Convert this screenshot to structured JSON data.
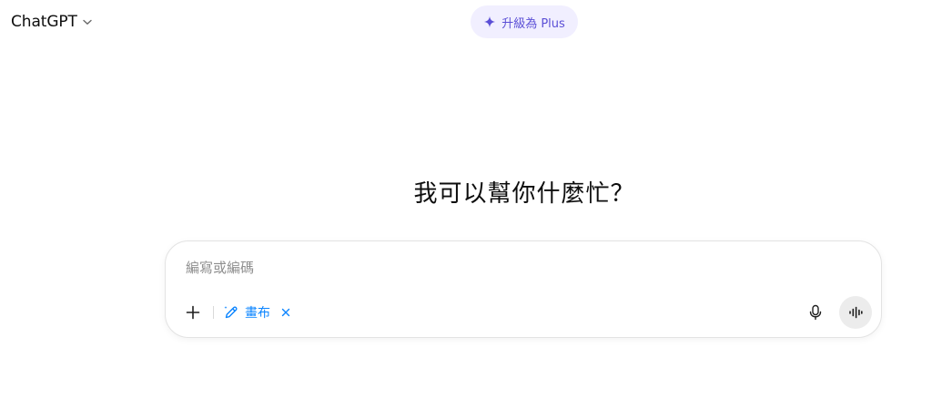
{
  "header": {
    "model_name": "ChatGPT",
    "upgrade_label": "升級為 Plus"
  },
  "main": {
    "title": "我可以幫你什麼忙？"
  },
  "composer": {
    "placeholder": "編寫或編碼",
    "value": "",
    "tool_chip_label": "畫布"
  },
  "icons": {
    "model_chevron": "chevron-down-icon",
    "upgrade": "sparkle-icon",
    "add": "plus-icon",
    "canvas": "pencil-sparkle-icon",
    "chip_close": "close-icon",
    "mic": "microphone-icon",
    "voice": "voice-waveform-icon"
  },
  "colors": {
    "accent_blue": "#0a84ff",
    "upgrade_bg": "#f1efff",
    "upgrade_text": "#5b4fd6",
    "voice_button_bg": "#ececec"
  }
}
